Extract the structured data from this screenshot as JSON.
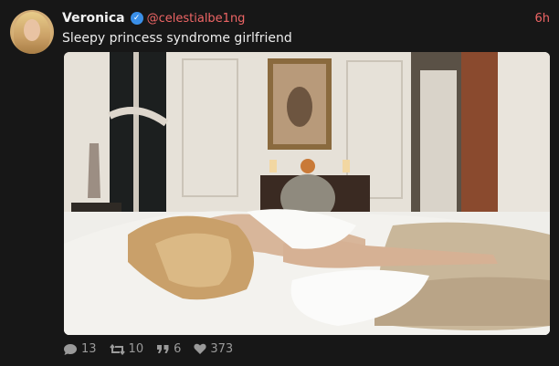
{
  "post": {
    "author_name": "Veronica",
    "verified_icon": "verified-check-icon",
    "handle": "@celestialbe1ng",
    "time": "6h",
    "text": "Sleepy princess syndrome girlfriend",
    "image_description_icon": "photo-media",
    "stats": {
      "replies": "13",
      "reposts": "10",
      "quotes": "6",
      "likes": "373"
    }
  },
  "colors": {
    "background": "#171717",
    "handle": "#ee6565",
    "verified": "#3a8fe8",
    "stat": "#9a9a9a"
  }
}
